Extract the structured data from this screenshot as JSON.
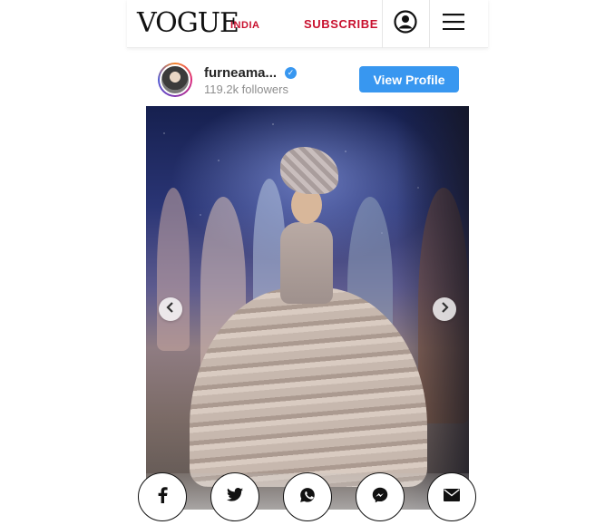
{
  "header": {
    "logo": "VOGUE",
    "edition": "INDIA",
    "subscribe_label": "SUBSCRIBE",
    "account_icon": "account-circle-icon",
    "menu_icon": "hamburger-menu-icon",
    "accent_color": "#c8102e"
  },
  "post": {
    "username": "furneama...",
    "verified_icon": "verified-badge-icon",
    "followers": "119.2k followers",
    "view_profile_label": "View Profile",
    "button_color": "#3897f0"
  },
  "carousel": {
    "prev_icon": "chevron-left-icon",
    "next_icon": "chevron-right-icon"
  },
  "share": [
    {
      "name": "facebook",
      "icon": "facebook-icon"
    },
    {
      "name": "twitter",
      "icon": "twitter-icon"
    },
    {
      "name": "whatsapp",
      "icon": "whatsapp-icon"
    },
    {
      "name": "messenger",
      "icon": "messenger-icon"
    },
    {
      "name": "email",
      "icon": "email-icon"
    }
  ]
}
